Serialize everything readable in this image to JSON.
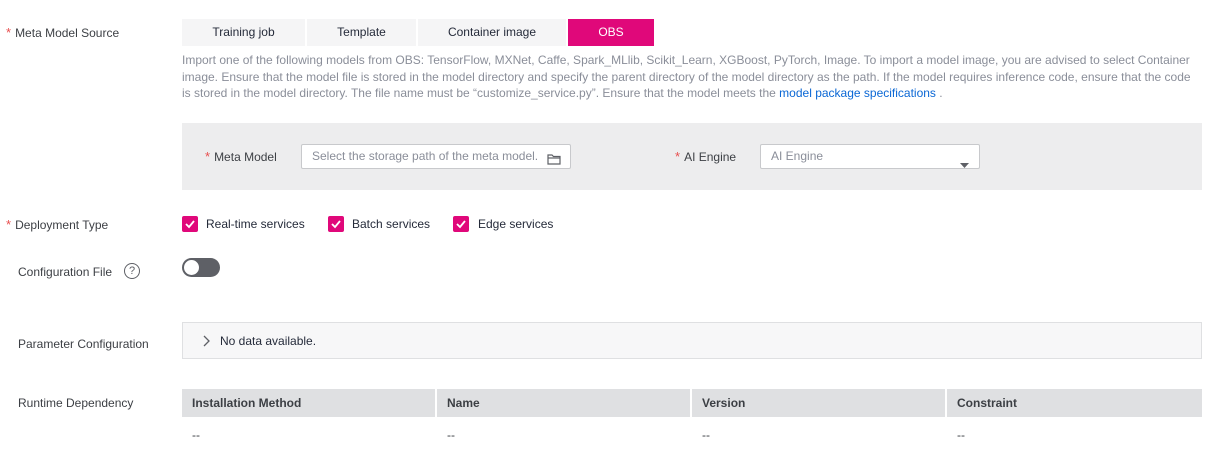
{
  "meta_model_source": {
    "label": "Meta Model Source",
    "tabs": [
      "Training job",
      "Template",
      "Container image",
      "OBS"
    ],
    "active_tab": "OBS",
    "description": "Import one of the following models from OBS: TensorFlow, MXNet, Caffe, Spark_MLlib, Scikit_Learn, XGBoost, PyTorch, Image. To import a model image, you are advised to select Container image. Ensure that the model file is stored in the model directory and specify the parent directory of the model directory as the path. If the model requires inference code, ensure that the code is stored in the model directory. The file name must be “customize_service.py”. Ensure that the model meets the ",
    "description_link": "model package specifications",
    "description_end": " ."
  },
  "meta_model": {
    "label": "Meta Model",
    "placeholder": "Select the storage path of the meta model."
  },
  "ai_engine": {
    "label": "AI Engine",
    "placeholder": "AI Engine"
  },
  "deployment_type": {
    "label": "Deployment Type",
    "options": [
      {
        "label": "Real-time services",
        "checked": true
      },
      {
        "label": "Batch services",
        "checked": true
      },
      {
        "label": "Edge services",
        "checked": true
      }
    ]
  },
  "configuration_file": {
    "label": "Configuration File",
    "enabled": false
  },
  "parameter_configuration": {
    "label": "Parameter Configuration",
    "empty_text": "No data available."
  },
  "runtime_dependency": {
    "label": "Runtime Dependency",
    "columns": [
      "Installation Method",
      "Name",
      "Version",
      "Constraint"
    ],
    "row": [
      "--",
      "--",
      "--",
      "--"
    ]
  },
  "colors": {
    "accent": "#e0087a",
    "link": "#0a67d5",
    "required": "#e84e4e"
  }
}
